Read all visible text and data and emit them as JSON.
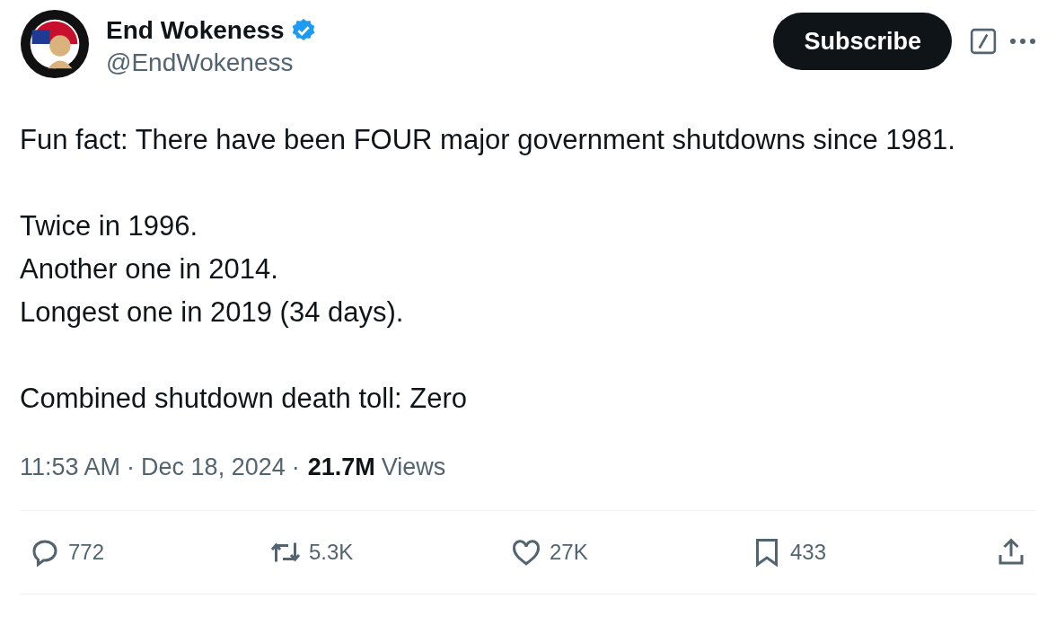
{
  "author": {
    "name": "End Wokeness",
    "handle": "@EndWokeness",
    "verified": true
  },
  "subscribe_button": "Subscribe",
  "paragraphs": [
    [
      "Fun fact: There have been FOUR major government shutdowns since 1981."
    ],
    [
      "Twice in 1996.",
      "Another one in 2014.",
      "Longest one in 2019 (34 days)."
    ],
    [
      "Combined shutdown death toll: Zero"
    ]
  ],
  "meta": {
    "time": "11:53 AM",
    "separator": "·",
    "date": "Dec 18, 2024",
    "views_count": "21.7M",
    "views_label": "Views"
  },
  "actions": [
    {
      "kind": "reply",
      "count": "772"
    },
    {
      "kind": "repost",
      "count": "5.3K"
    },
    {
      "kind": "like",
      "count": "27K"
    },
    {
      "kind": "bookmark",
      "count": "433"
    },
    {
      "kind": "share"
    }
  ]
}
